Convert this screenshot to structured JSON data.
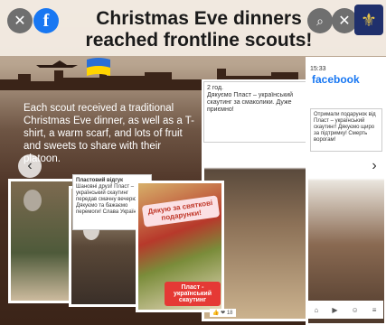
{
  "header": {
    "title_line1": "Christmas Eve dinners",
    "title_line2": "reached frontline scouts!",
    "close_glyph": "✕",
    "zoom_glyph": "⌕",
    "fb_glyph": "f",
    "emblem_glyph": "⚜"
  },
  "description": "Each scout received a traditional Christmas Eve dinner, as well as a T-shirt, a warm scarf, and lots of fruit and sweets to share with their platoon.",
  "navigation": {
    "prev": "‹",
    "next": "›"
  },
  "collage": {
    "fb_post_date": "2 год.",
    "fb_post_text": "Дякуємо Пласт – український скаутинг за смаколики. Дуже приємно!",
    "story_time": "15:33",
    "story_logo": "facebook",
    "story_text": "Отримали подарунок від Пласт – український скаутинг! Дякуємо щиро за підтримку! Смерть ворогам!",
    "message_title": "Пластовий відгук",
    "message_text": "Шановні друзі! Пласт – український скаутинг передав смачну вечерю. Дякуємо та бажаємо перемоги! Слава Україні!",
    "sticker_text": "Дякую за святкові подарунки!",
    "tag_text": "Пласт - український скаутинг",
    "likes_text": "👍 ❤ 18"
  },
  "colors": {
    "banner": "#f4ede4",
    "facebook_blue": "#1877f2",
    "flag_blue": "#2a6fd6",
    "flag_yellow": "#ffd400",
    "emblem_bg": "#20306c"
  }
}
